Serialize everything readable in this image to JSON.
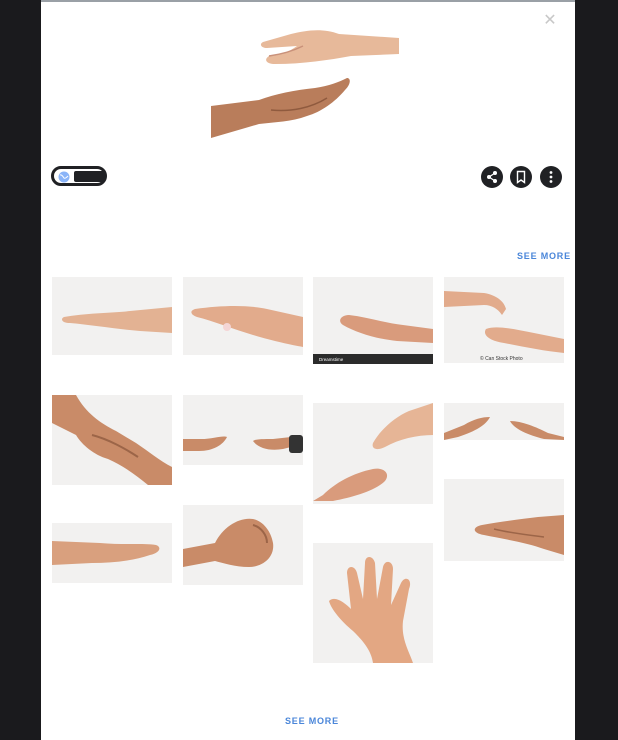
{
  "viewer": {
    "close_icon": "close-icon",
    "source_chip_icon": "globe-icon",
    "actions": [
      "share-icon",
      "bookmark-icon",
      "more-vert-icon"
    ]
  },
  "related": {
    "see_more_top": "SEE MORE",
    "see_more_bottom": "SEE MORE",
    "accent_color": "#4a86d9"
  },
  "thumbnails": [
    {
      "id": 1,
      "caption": ""
    },
    {
      "id": 2,
      "caption": ""
    },
    {
      "id": 3,
      "caption": "Dreamstime"
    },
    {
      "id": 4,
      "caption": "© Can Stock Photo"
    },
    {
      "id": 5,
      "caption": ""
    },
    {
      "id": 6,
      "caption": ""
    },
    {
      "id": 7,
      "caption": ""
    },
    {
      "id": 8,
      "caption": ""
    },
    {
      "id": 9,
      "caption": ""
    },
    {
      "id": 10,
      "caption": ""
    },
    {
      "id": 11,
      "caption": ""
    },
    {
      "id": 12,
      "caption": ""
    }
  ]
}
